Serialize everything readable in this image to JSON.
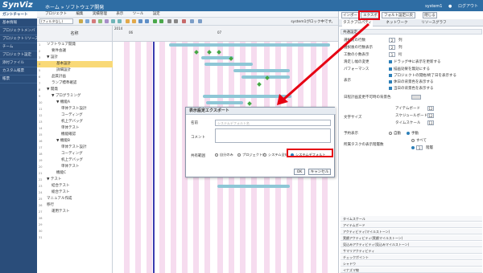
{
  "app": {
    "logo": "SynViz",
    "breadcrumb": "ホーム » ソフトウェア開発",
    "user": "system1",
    "logout": "ログアウト"
  },
  "sidebar": {
    "items": [
      "ガントチャート",
      "基本情報",
      "プロジェクトメンバ",
      "プロジェクトリソース",
      "チーム",
      "プロジェクト設定",
      "添付ファイル",
      "カスタム帳票",
      "帳票"
    ],
    "active": 0
  },
  "menubar": {
    "items": [
      "プロジェクト",
      "編集",
      "実績管理",
      "表示",
      "ツール",
      "設定"
    ]
  },
  "toolbar": {
    "filter": "(フィルタなし)",
    "status": "system1がロック中です。"
  },
  "tree": {
    "header": "名称",
    "rows": [
      {
        "n": "1",
        "label": "ソフトウェア開発",
        "lvl": 0
      },
      {
        "n": "2",
        "label": "要件会議",
        "lvl": 1
      },
      {
        "n": "3",
        "label": "▼ 設計",
        "lvl": 0
      },
      {
        "n": "4",
        "label": "基本設計",
        "lvl": 2,
        "selected": true
      },
      {
        "n": "5",
        "label": "詳細設計",
        "lvl": 2
      },
      {
        "n": "6",
        "label": "品質計画",
        "lvl": 1
      },
      {
        "n": "7",
        "label": "ランプ標準確認",
        "lvl": 1
      },
      {
        "n": "8",
        "label": "▼ 開発",
        "lvl": 0
      },
      {
        "n": "9",
        "label": "▼ プログラミング",
        "lvl": 1
      },
      {
        "n": "10",
        "label": "▼ 機能A",
        "lvl": 2
      },
      {
        "n": "11",
        "label": "単体テスト設計",
        "lvl": 3
      },
      {
        "n": "12",
        "label": "コーディング",
        "lvl": 3
      },
      {
        "n": "13",
        "label": "机上デバッグ",
        "lvl": 3
      },
      {
        "n": "14",
        "label": "単体テスト",
        "lvl": 3
      },
      {
        "n": "15",
        "label": "機能確認",
        "lvl": 3
      },
      {
        "n": "16",
        "label": "▼ 機能B",
        "lvl": 2
      },
      {
        "n": "17",
        "label": "単体テスト設計",
        "lvl": 3
      },
      {
        "n": "18",
        "label": "コーディング",
        "lvl": 3
      },
      {
        "n": "19",
        "label": "机上デバッグ",
        "lvl": 3
      },
      {
        "n": "20",
        "label": "単体テスト",
        "lvl": 3
      },
      {
        "n": "21",
        "label": "機能C",
        "lvl": 2
      },
      {
        "n": "22",
        "label": "▼ テスト",
        "lvl": 0
      },
      {
        "n": "23",
        "label": "結合テスト",
        "lvl": 1
      },
      {
        "n": "24",
        "label": "総合テスト",
        "lvl": 1
      },
      {
        "n": "25",
        "label": "マニュアル作成",
        "lvl": 0
      },
      {
        "n": "26",
        "label": "移行",
        "lvl": 0
      },
      {
        "n": "27",
        "label": "運用テスト",
        "lvl": 1
      },
      {
        "n": "28",
        "label": "",
        "lvl": 0
      },
      {
        "n": "29",
        "label": "",
        "lvl": 0
      },
      {
        "n": "30",
        "label": "",
        "lvl": 0
      },
      {
        "n": "31",
        "label": "",
        "lvl": 0
      }
    ]
  },
  "gantt": {
    "year_label": "2014",
    "month1": "06",
    "month2": "07"
  },
  "panel": {
    "buttons": {
      "import": "インポート",
      "export": "エクスポート",
      "reset": "フォルト設定に戻す",
      "close": "閉じる"
    },
    "tabs": {
      "tab1": "タスクプロパティ",
      "tab2": "ネットワーク",
      "tab3": "リソースグラフ"
    },
    "section_common": "共通設定",
    "fields": {
      "a": "選択前の行数",
      "a_val": "2",
      "a_unit": "列",
      "b": "選択後の行数表示",
      "b_val": "2",
      "b_unit": "列",
      "c": "工数の小数表示",
      "c_val": "1",
      "c_unit": "桁",
      "d": "滑走し幅の変更",
      "d_opt": "ドラッグ中に表示を更新する",
      "e": "パフォーマンス",
      "e_opt": "描画効果を無効にする",
      "f": "表示",
      "f_opt1": "プロジェクトの開始/終了日を表示する",
      "f_opt2": "休日の背景色を表示する",
      "f_opt3": "当日の背景色を表示する",
      "g": "日程計画変更不可時の背景色",
      "h": "文字サイズ",
      "h_opt1": "アイテムボード",
      "h_val1": "12",
      "h_opt2": "スケジュールボード",
      "h_val2": "12",
      "h_opt3": "タイムスケール",
      "h_val3": "11",
      "i": "予約表示",
      "i_opt1": "自動",
      "i_opt2": "手動",
      "j": "所属タスクの表示階層数",
      "j_opt1": "すべて",
      "j_val": "1",
      "j_unit": "階層"
    },
    "accordions": [
      "タイムスケール",
      "アイテムボード",
      "アクティビティ(マイルストーン)",
      "実績アクティビティ(実績マイルストーン)",
      "見込みアクティビティ(見込みマイルストーン)",
      "サマリアクティビティ",
      "チェックポイント",
      "シャドウ",
      "イナズマ線"
    ]
  },
  "dialog": {
    "title": "表示設定エクスポート",
    "name_label": "名前",
    "name_placeholder": "システムデフォルト名",
    "comment_label": "コメント",
    "scope_label": "共有範囲",
    "scope_opts": [
      "自分のみ",
      "プロジェクト内",
      "システム全体",
      "システムデフォルト"
    ],
    "scope_selected": 3,
    "ok": "OK",
    "cancel": "キャンセル"
  },
  "colors": {
    "highlight": "#e60012",
    "topbar": "#2e6da4",
    "sidebar": "#2a4d7a",
    "weekend": "#f6dcef"
  }
}
